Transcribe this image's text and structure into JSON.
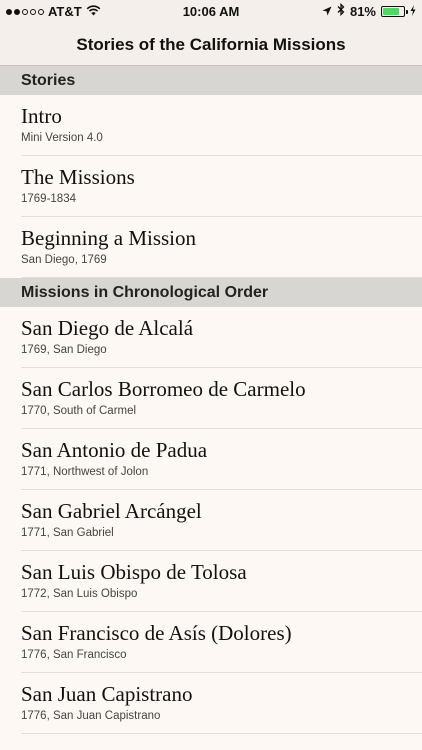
{
  "status_bar": {
    "carrier": "AT&T",
    "time": "10:06 AM",
    "battery_percent": "81%",
    "battery_level": 0.81,
    "signal_bars_filled": 2,
    "signal_bars_total": 5,
    "icons": [
      "wifi-icon",
      "location-icon",
      "bluetooth-icon",
      "battery-icon",
      "charging-icon"
    ]
  },
  "nav": {
    "title": "Stories of the California Missions"
  },
  "sections": [
    {
      "header": "Stories",
      "items": [
        {
          "title": "Intro",
          "subtitle": "Mini Version 4.0"
        },
        {
          "title": "The Missions",
          "subtitle": "1769-1834"
        },
        {
          "title": "Beginning a Mission",
          "subtitle": "San Diego, 1769"
        }
      ]
    },
    {
      "header": "Missions in Chronological Order",
      "items": [
        {
          "title": "San Diego de Alcalá",
          "subtitle": "1769, San Diego"
        },
        {
          "title": "San Carlos Borromeo de Carmelo",
          "subtitle": "1770, South of Carmel"
        },
        {
          "title": "San Antonio de Padua",
          "subtitle": "1771, Northwest of Jolon"
        },
        {
          "title": "San Gabriel Arcángel",
          "subtitle": "1771, San Gabriel"
        },
        {
          "title": "San Luis Obispo de Tolosa",
          "subtitle": "1772, San Luis Obispo"
        },
        {
          "title": "San Francisco de Asís (Dolores)",
          "subtitle": "1776, San Francisco"
        },
        {
          "title": "San Juan Capistrano",
          "subtitle": "1776, San Juan Capistrano"
        }
      ]
    }
  ],
  "colors": {
    "background": "#fdf8f3",
    "section_header": "#d8d6d3",
    "nav_background": "#f4efea",
    "battery": "#4cd964"
  }
}
